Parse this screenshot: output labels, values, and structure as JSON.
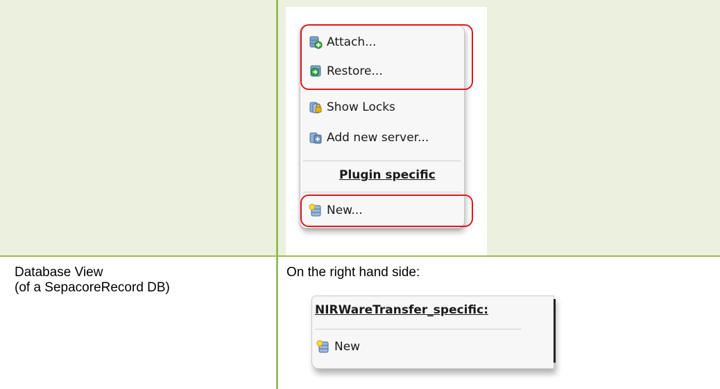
{
  "top_row": {
    "context_menu": {
      "items": [
        {
          "label": "Attach...",
          "icon": "database-attach-icon"
        },
        {
          "label": "Restore...",
          "icon": "database-restore-icon"
        },
        {
          "label": "Show Locks",
          "icon": "database-locks-icon"
        },
        {
          "label": "Add new server...",
          "icon": "add-server-icon"
        }
      ],
      "section_header": "Plugin specific",
      "plugin_items": [
        {
          "label": "New...",
          "icon": "database-new-icon"
        }
      ]
    }
  },
  "bottom_row": {
    "left_text": [
      "Database View",
      "(of a SepacoreRecord DB)"
    ],
    "right_text": "On the right hand side:",
    "context_menu": {
      "section_header": "NIRWareTransfer_specific:",
      "items": [
        {
          "label": "New",
          "icon": "database-new-icon"
        }
      ]
    }
  },
  "colors": {
    "cell_background": "#ebf1de",
    "border": "#9bbb59",
    "highlight": "#e0161a"
  }
}
